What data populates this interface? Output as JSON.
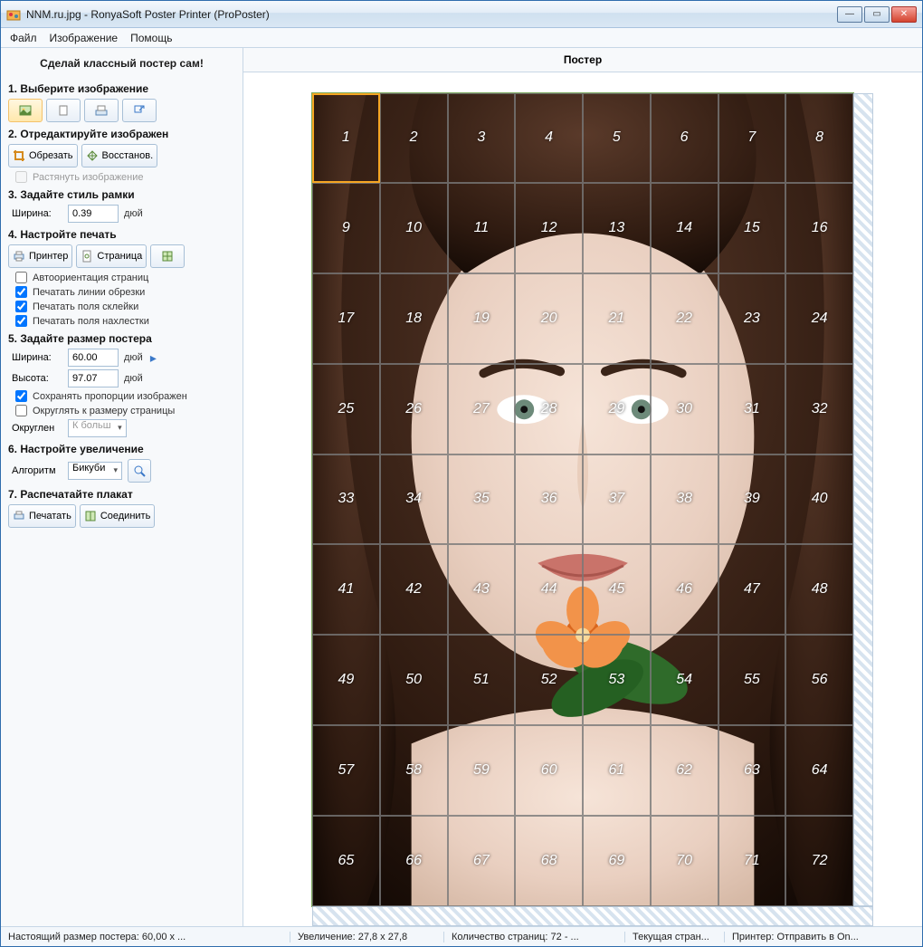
{
  "window": {
    "title": "NNM.ru.jpg - RonyaSoft Poster Printer (ProPoster)"
  },
  "menu": {
    "file": "Файл",
    "image": "Изображение",
    "help": "Помощь"
  },
  "sidebar": {
    "header": "Сделай классный постер сам!",
    "step1": {
      "title": "1. Выберите изображение"
    },
    "step2": {
      "title": "2. Отредактируйте изображен",
      "crop": "Обрезать",
      "restore": "Восстанов.",
      "stretch": "Растянуть изображение"
    },
    "step3": {
      "title": "3. Задайте стиль рамки",
      "width_label": "Ширина:",
      "width_value": "0.39",
      "unit": "дюй"
    },
    "step4": {
      "title": "4. Настройте печать",
      "printer": "Принтер",
      "page": "Страница",
      "auto_orient": "Автоориентация страниц",
      "print_cut": "Печатать линии обрезки",
      "print_glue": "Печатать поля склейки",
      "print_overlap": "Печатать поля нахлестки"
    },
    "step5": {
      "title": "5. Задайте размер постера",
      "width_label": "Ширина:",
      "width_value": "60.00",
      "height_label": "Высота:",
      "height_value": "97.07",
      "unit": "дюй",
      "keep_ratio": "Сохранять пропорции изображен",
      "round_page": "Округлять к размеру страницы",
      "round_label": "Округлен",
      "round_value": "К больш"
    },
    "step6": {
      "title": "6. Настройте увеличение",
      "algo_label": "Алгоритм",
      "algo_value": "Бикуби"
    },
    "step7": {
      "title": "7. Распечатайте плакат",
      "print": "Печатать",
      "join": "Соединить"
    }
  },
  "main": {
    "header": "Постер",
    "grid_cols": 8,
    "grid_rows": 9,
    "selected_cell": 1
  },
  "status": {
    "real_size": "Настоящий размер постера: 60,00 x ...",
    "zoom": "Увеличение: 27,8 x 27,8",
    "pages": "Количество страниц: 72 - ...",
    "current": "Текущая стран...",
    "printer": "Принтер: Отправить в On..."
  }
}
